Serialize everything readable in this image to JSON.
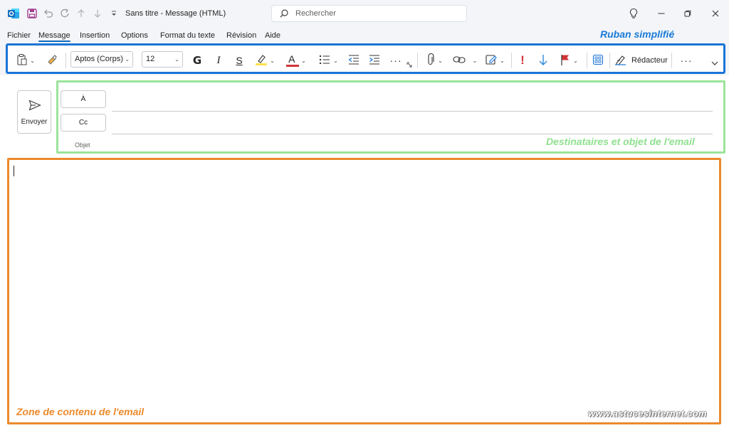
{
  "app": {
    "title": "Sans titre  -  Message (HTML)"
  },
  "search": {
    "placeholder": "Rechercher"
  },
  "menu": [
    "Fichier",
    "Message",
    "Insertion",
    "Options",
    "Format du texte",
    "Révision",
    "Aide"
  ],
  "menu_active": "Message",
  "ribbon": {
    "font_name": "Aptos (Corps)",
    "font_size": "12",
    "bold_label": "G",
    "italic_label": "I",
    "strike_label": "S",
    "font_color_label": "A",
    "more_label": "···",
    "importance_label": "!",
    "editor_label": "Rédacteur",
    "overflow_label": "···"
  },
  "compose": {
    "send_label": "Envoyer",
    "to_label": "À",
    "cc_label": "Cc",
    "subject_label": "Objet"
  },
  "annotations": {
    "ribbon": "Ruban simplifié",
    "recipients": "Destinataires et objet de l'email",
    "body": "Zone de contenu de l'email",
    "watermark": "www.astucesinternet.com"
  },
  "colors": {
    "accent": "#0f6cbd",
    "ribbon_frame": "#1a74d6",
    "recipients_frame": "#9be49b",
    "body_frame": "#ec8a2c",
    "highlight": "#ffe14d",
    "font_color": "#d13438",
    "importance": "#d13438",
    "low_importance": "#2a88d8"
  }
}
